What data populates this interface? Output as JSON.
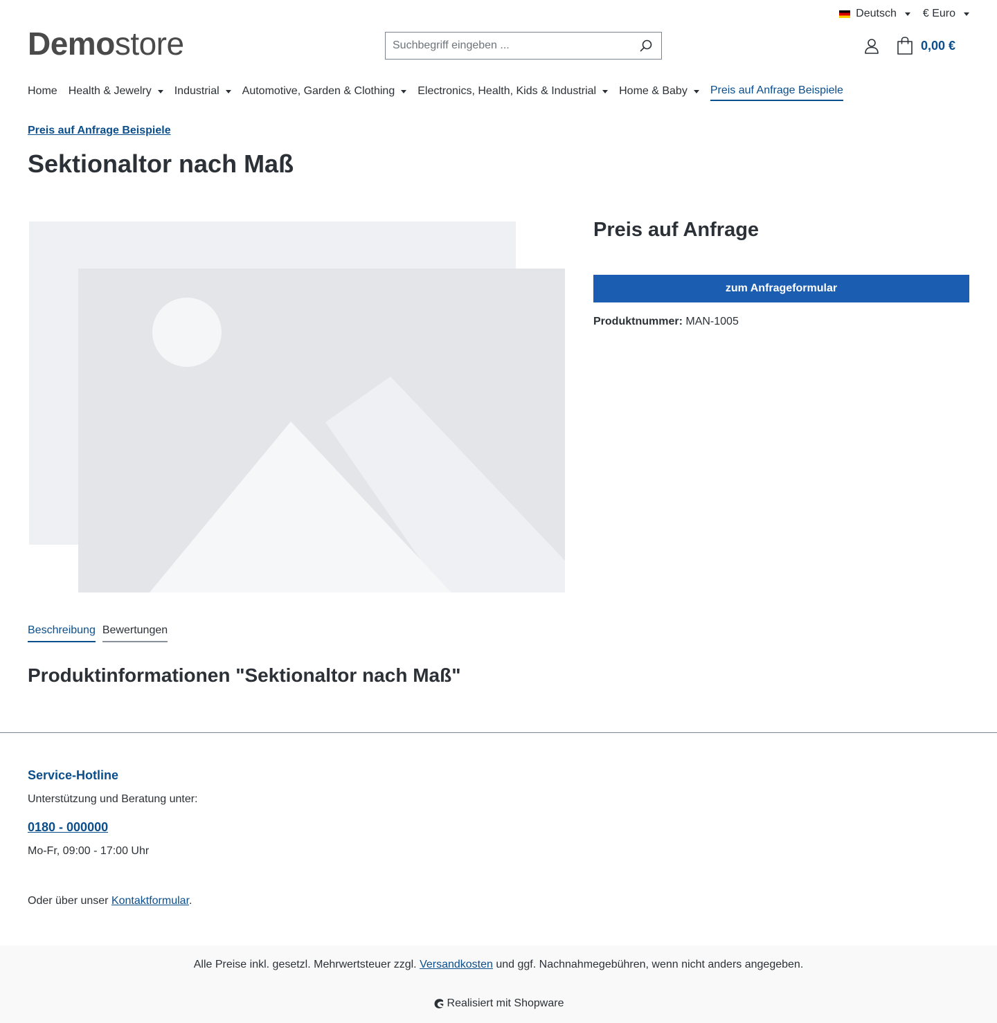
{
  "topbar": {
    "language": "Deutsch",
    "currency": "€ Euro"
  },
  "header": {
    "logo_bold": "Demo",
    "logo_light": "store",
    "search_placeholder": "Suchbegriff eingeben ...",
    "cart_total": "0,00 €"
  },
  "nav": {
    "items": [
      {
        "label": "Home",
        "dropdown": false
      },
      {
        "label": "Health & Jewelry",
        "dropdown": true
      },
      {
        "label": "Industrial",
        "dropdown": true
      },
      {
        "label": "Automotive, Garden & Clothing",
        "dropdown": true
      },
      {
        "label": "Electronics, Health, Kids & Industrial",
        "dropdown": true
      },
      {
        "label": "Home & Baby",
        "dropdown": true
      },
      {
        "label": "Preis auf Anfrage Beispiele",
        "dropdown": false,
        "active": true
      }
    ]
  },
  "breadcrumb": "Preis auf Anfrage Beispiele",
  "product": {
    "title": "Sektionaltor nach Maß",
    "price_label": "Preis auf Anfrage",
    "inquiry_button": "zum Anfrageformular",
    "number_label": "Produktnummer:",
    "number_value": "MAN-1005"
  },
  "tabs": {
    "description": "Beschreibung",
    "reviews": "Bewertungen"
  },
  "product_info_title": "Produktinformationen \"Sektionaltor nach Maß\"",
  "footer": {
    "hotline_title": "Service-Hotline",
    "hotline_sub": "Unterstützung und Beratung unter:",
    "phone": "0180 - 000000",
    "hours": "Mo-Fr, 09:00 - 17:00 Uhr",
    "contact_prefix": "Oder über unser ",
    "contact_link": "Kontaktformular",
    "contact_suffix": ".",
    "vat_prefix": "Alle Preise inkl. gesetzl. Mehrwertsteuer zzgl. ",
    "vat_link": "Versandkosten",
    "vat_suffix": " und ggf. Nachnahmegebühren, wenn nicht anders angegeben.",
    "powered": "Realisiert mit Shopware"
  },
  "colors": {
    "primary": "#0b4e8c",
    "button": "#1b5eb1",
    "text": "#2b3136"
  }
}
